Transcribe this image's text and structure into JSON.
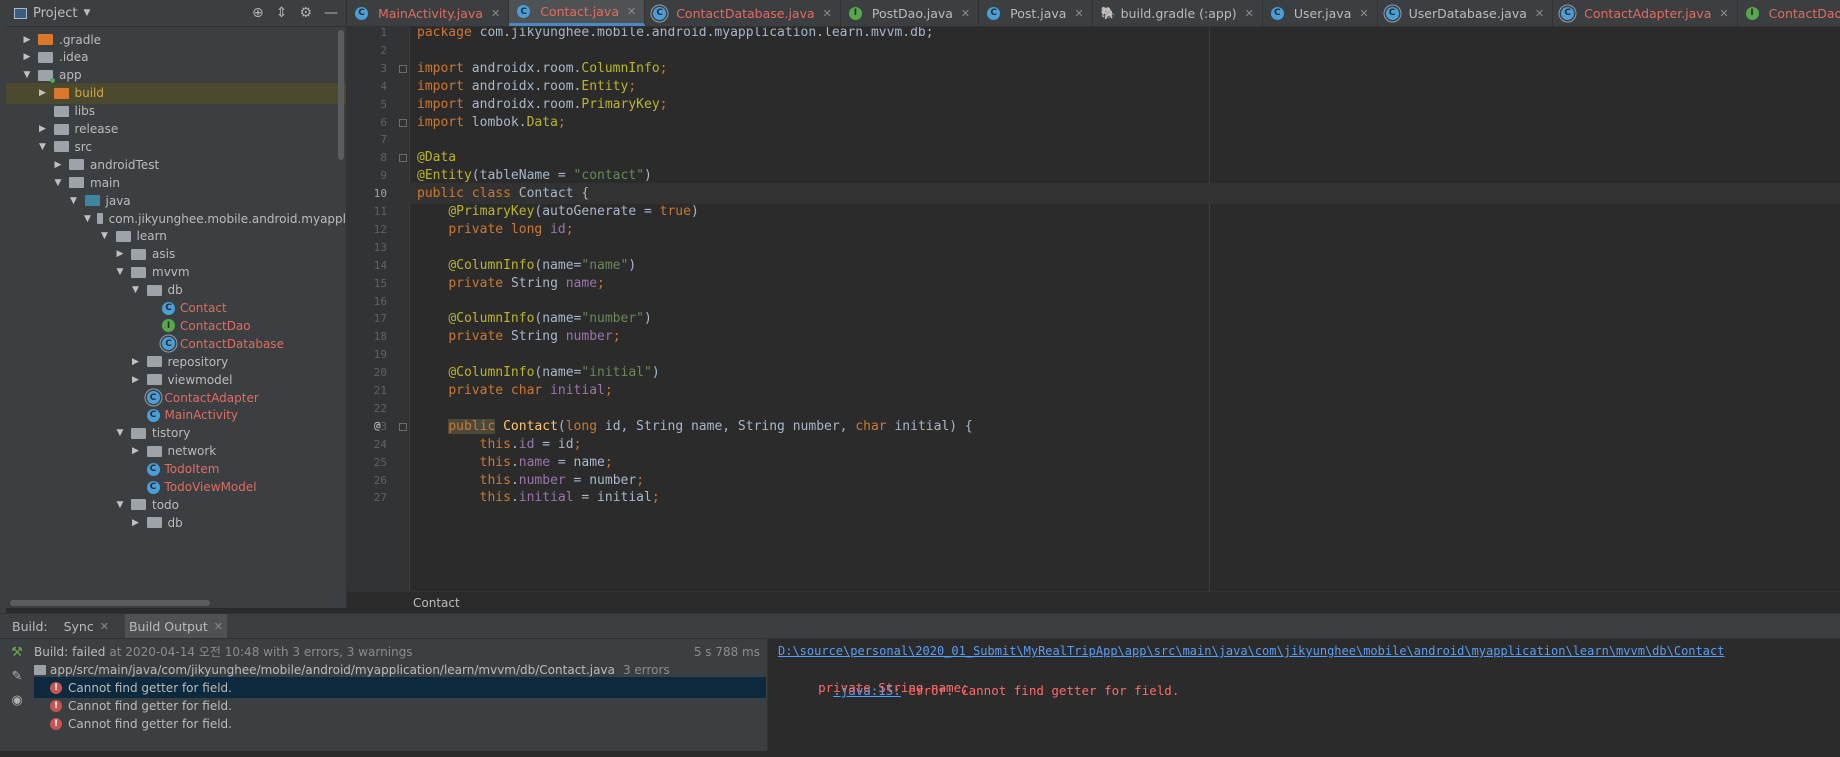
{
  "project_panel": {
    "title": "Project",
    "tree": [
      {
        "label": ".gradle",
        "depth": 0,
        "arrow": "right",
        "icon": "folder-orange",
        "style": "normal"
      },
      {
        "label": ".idea",
        "depth": 0,
        "arrow": "right",
        "icon": "folder-gray",
        "style": "normal"
      },
      {
        "label": "app",
        "depth": 0,
        "arrow": "down",
        "icon": "folder-module",
        "style": "normal"
      },
      {
        "label": "build",
        "depth": 1,
        "arrow": "right",
        "icon": "folder-orange",
        "style": "orange",
        "selected": true
      },
      {
        "label": "libs",
        "depth": 1,
        "arrow": "none",
        "icon": "folder-gray",
        "style": "normal"
      },
      {
        "label": "release",
        "depth": 1,
        "arrow": "right",
        "icon": "folder-gray",
        "style": "normal"
      },
      {
        "label": "src",
        "depth": 1,
        "arrow": "down",
        "icon": "folder-gray",
        "style": "normal"
      },
      {
        "label": "androidTest",
        "depth": 2,
        "arrow": "right",
        "icon": "folder-gray",
        "style": "normal"
      },
      {
        "label": "main",
        "depth": 2,
        "arrow": "down",
        "icon": "folder-gray",
        "style": "normal"
      },
      {
        "label": "java",
        "depth": 3,
        "arrow": "down",
        "icon": "folder-blue",
        "style": "normal"
      },
      {
        "label": "com.jikyunghee.mobile.android.myappl",
        "depth": 4,
        "arrow": "down",
        "icon": "folder-gray",
        "style": "normal"
      },
      {
        "label": "learn",
        "depth": 5,
        "arrow": "down",
        "icon": "folder-gray",
        "style": "normal"
      },
      {
        "label": "asis",
        "depth": 6,
        "arrow": "right",
        "icon": "folder-gray",
        "style": "normal"
      },
      {
        "label": "mvvm",
        "depth": 6,
        "arrow": "down",
        "icon": "folder-gray",
        "style": "normal"
      },
      {
        "label": "db",
        "depth": 7,
        "arrow": "down",
        "icon": "folder-gray",
        "style": "normal"
      },
      {
        "label": "Contact",
        "depth": 8,
        "arrow": "none",
        "icon": "class-c",
        "style": "red"
      },
      {
        "label": "ContactDao",
        "depth": 8,
        "arrow": "none",
        "icon": "class-i",
        "style": "red"
      },
      {
        "label": "ContactDatabase",
        "depth": 8,
        "arrow": "none",
        "icon": "class-a",
        "style": "red"
      },
      {
        "label": "repository",
        "depth": 7,
        "arrow": "right",
        "icon": "folder-gray",
        "style": "normal"
      },
      {
        "label": "viewmodel",
        "depth": 7,
        "arrow": "right",
        "icon": "folder-gray",
        "style": "normal"
      },
      {
        "label": "ContactAdapter",
        "depth": 7,
        "arrow": "none",
        "icon": "class-a",
        "style": "red"
      },
      {
        "label": "MainActivity",
        "depth": 7,
        "arrow": "none",
        "icon": "class-c",
        "style": "red"
      },
      {
        "label": "tistory",
        "depth": 6,
        "arrow": "down",
        "icon": "folder-gray",
        "style": "normal"
      },
      {
        "label": "network",
        "depth": 7,
        "arrow": "right",
        "icon": "folder-gray",
        "style": "normal"
      },
      {
        "label": "TodoItem",
        "depth": 7,
        "arrow": "none",
        "icon": "class-c",
        "style": "red"
      },
      {
        "label": "TodoViewModel",
        "depth": 7,
        "arrow": "none",
        "icon": "class-c",
        "style": "red"
      },
      {
        "label": "todo",
        "depth": 6,
        "arrow": "down",
        "icon": "folder-gray",
        "style": "normal"
      },
      {
        "label": "db",
        "depth": 7,
        "arrow": "right",
        "icon": "folder-gray",
        "style": "normal"
      }
    ]
  },
  "tabs": [
    {
      "label": "MainActivity.java",
      "icon": "class-c",
      "red": true,
      "active": false
    },
    {
      "label": "Contact.java",
      "icon": "class-c",
      "red": true,
      "active": true
    },
    {
      "label": "ContactDatabase.java",
      "icon": "class-a",
      "red": true,
      "active": false
    },
    {
      "label": "PostDao.java",
      "icon": "class-i",
      "red": false,
      "active": false
    },
    {
      "label": "Post.java",
      "icon": "class-c",
      "red": false,
      "active": false
    },
    {
      "label": "build.gradle (:app)",
      "icon": "gradle",
      "red": false,
      "active": false
    },
    {
      "label": "User.java",
      "icon": "class-c",
      "red": false,
      "active": false
    },
    {
      "label": "UserDatabase.java",
      "icon": "class-a",
      "red": false,
      "active": false
    },
    {
      "label": "ContactAdapter.java",
      "icon": "class-a",
      "red": true,
      "active": false
    },
    {
      "label": "ContactDao.java",
      "icon": "class-i",
      "red": true,
      "active": false
    }
  ],
  "editor": {
    "current_line": 10,
    "lines": [
      {
        "n": "1",
        "tokens": [
          [
            "kw",
            "package "
          ],
          [
            "cls",
            "com.jikyunghee.mobile.android.myapplication.learn.mvvm.db;"
          ]
        ]
      },
      {
        "n": "2",
        "tokens": []
      },
      {
        "n": "3",
        "fold": true,
        "tokens": [
          [
            "kw",
            "import "
          ],
          [
            "cls",
            "androidx.room."
          ],
          [
            "ann",
            "ColumnInfo"
          ],
          [
            "kw",
            ";"
          ]
        ]
      },
      {
        "n": "4",
        "tokens": [
          [
            "kw",
            "import "
          ],
          [
            "cls",
            "androidx.room."
          ],
          [
            "ann",
            "Entity"
          ],
          [
            "kw",
            ";"
          ]
        ]
      },
      {
        "n": "5",
        "tokens": [
          [
            "kw",
            "import "
          ],
          [
            "cls",
            "androidx.room."
          ],
          [
            "ann",
            "PrimaryKey"
          ],
          [
            "kw",
            ";"
          ]
        ]
      },
      {
        "n": "6",
        "fold": true,
        "tokens": [
          [
            "kw",
            "import "
          ],
          [
            "cls",
            "lombok."
          ],
          [
            "ann",
            "Data"
          ],
          [
            "kw",
            ";"
          ]
        ]
      },
      {
        "n": "7",
        "tokens": []
      },
      {
        "n": "8",
        "fold": true,
        "tokens": [
          [
            "ann",
            "@Data"
          ]
        ]
      },
      {
        "n": "9",
        "tokens": [
          [
            "ann",
            "@Entity"
          ],
          [
            "cls",
            "(tableName = "
          ],
          [
            "str",
            "\"contact\""
          ],
          [
            "cls",
            ")"
          ]
        ]
      },
      {
        "n": "10",
        "tokens": [
          [
            "kw",
            "public class "
          ],
          [
            "cls",
            "Contact "
          ],
          [
            "cls",
            "{"
          ]
        ]
      },
      {
        "n": "11",
        "tokens": [
          [
            "cls",
            "    "
          ],
          [
            "ann",
            "@PrimaryKey"
          ],
          [
            "cls",
            "(autoGenerate = "
          ],
          [
            "kw",
            "true"
          ],
          [
            "cls",
            ")"
          ]
        ]
      },
      {
        "n": "12",
        "tokens": [
          [
            "cls",
            "    "
          ],
          [
            "kw",
            "private long "
          ],
          [
            "fld",
            "id"
          ],
          [
            "kw",
            ";"
          ]
        ]
      },
      {
        "n": "13",
        "tokens": []
      },
      {
        "n": "14",
        "tokens": [
          [
            "cls",
            "    "
          ],
          [
            "ann",
            "@ColumnInfo"
          ],
          [
            "cls",
            "(name="
          ],
          [
            "str",
            "\"name\""
          ],
          [
            "cls",
            ")"
          ]
        ]
      },
      {
        "n": "15",
        "tokens": [
          [
            "cls",
            "    "
          ],
          [
            "kw",
            "private "
          ],
          [
            "cls",
            "String "
          ],
          [
            "fld",
            "name"
          ],
          [
            "kw",
            ";"
          ]
        ]
      },
      {
        "n": "16",
        "tokens": []
      },
      {
        "n": "17",
        "tokens": [
          [
            "cls",
            "    "
          ],
          [
            "ann",
            "@ColumnInfo"
          ],
          [
            "cls",
            "(name="
          ],
          [
            "str",
            "\"number\""
          ],
          [
            "cls",
            ")"
          ]
        ]
      },
      {
        "n": "18",
        "tokens": [
          [
            "cls",
            "    "
          ],
          [
            "kw",
            "private "
          ],
          [
            "cls",
            "String "
          ],
          [
            "fld",
            "number"
          ],
          [
            "kw",
            ";"
          ]
        ]
      },
      {
        "n": "19",
        "tokens": []
      },
      {
        "n": "20",
        "tokens": [
          [
            "cls",
            "    "
          ],
          [
            "ann",
            "@ColumnInfo"
          ],
          [
            "cls",
            "(name="
          ],
          [
            "str",
            "\"initial\""
          ],
          [
            "cls",
            ")"
          ]
        ]
      },
      {
        "n": "21",
        "tokens": [
          [
            "cls",
            "    "
          ],
          [
            "kw",
            "private char "
          ],
          [
            "fld",
            "initial"
          ],
          [
            "kw",
            ";"
          ]
        ]
      },
      {
        "n": "22",
        "tokens": []
      },
      {
        "n": "23",
        "at": true,
        "fold": true,
        "tokens": [
          [
            "cls",
            "    "
          ],
          [
            "kwhl",
            "public"
          ],
          [
            "cls",
            " "
          ],
          [
            "fn",
            "Contact"
          ],
          [
            "cls",
            "("
          ],
          [
            "kw",
            "long "
          ],
          [
            "cls",
            "id, String name, String number, "
          ],
          [
            "kw",
            "char "
          ],
          [
            "cls",
            "initial) {"
          ]
        ]
      },
      {
        "n": "24",
        "tokens": [
          [
            "cls",
            "        "
          ],
          [
            "kw",
            "this"
          ],
          [
            "cls",
            "."
          ],
          [
            "fld",
            "id"
          ],
          [
            "cls",
            " = id"
          ],
          [
            "kw",
            ";"
          ]
        ]
      },
      {
        "n": "25",
        "tokens": [
          [
            "cls",
            "        "
          ],
          [
            "kw",
            "this"
          ],
          [
            "cls",
            "."
          ],
          [
            "fld",
            "name"
          ],
          [
            "cls",
            " = name"
          ],
          [
            "kw",
            ";"
          ]
        ]
      },
      {
        "n": "26",
        "tokens": [
          [
            "cls",
            "        "
          ],
          [
            "kw",
            "this"
          ],
          [
            "cls",
            "."
          ],
          [
            "fld",
            "number"
          ],
          [
            "cls",
            " = number"
          ],
          [
            "kw",
            ";"
          ]
        ]
      },
      {
        "n": "27",
        "tokens": [
          [
            "cls",
            "        "
          ],
          [
            "kw",
            "this"
          ],
          [
            "cls",
            "."
          ],
          [
            "fld",
            "initial"
          ],
          [
            "cls",
            " = initial"
          ],
          [
            "kw",
            ";"
          ]
        ]
      }
    ]
  },
  "breadcrumb": "Contact",
  "build_panel": {
    "label": "Build:",
    "tabs": [
      {
        "label": "Sync",
        "active": false
      },
      {
        "label": "Build Output",
        "active": true
      }
    ],
    "status_prefix": "Build:",
    "status_text": "failed",
    "status_detail": "at 2020-04-14 오전 10:48 with 3 errors, 3 warnings",
    "duration": "5 s 788 ms",
    "file_path": "app/src/main/java/com/jikyunghee/mobile/android/myapplication/learn/mvvm/db/Contact.java",
    "file_errors": "3 errors",
    "errors": [
      "Cannot find getter for field.",
      "Cannot find getter for field.",
      "Cannot find getter for field."
    ],
    "output_link_1": "D:\\source\\personal\\2020_01_Submit\\MyRealTripApp\\app\\src\\main\\java\\com\\jikyunghee\\mobile\\android\\myapplication\\learn\\mvvm\\db\\Contact",
    "output_link_2": ".java:15:",
    "output_error": " error: Cannot find getter for field.",
    "output_code": "    private String name;"
  }
}
